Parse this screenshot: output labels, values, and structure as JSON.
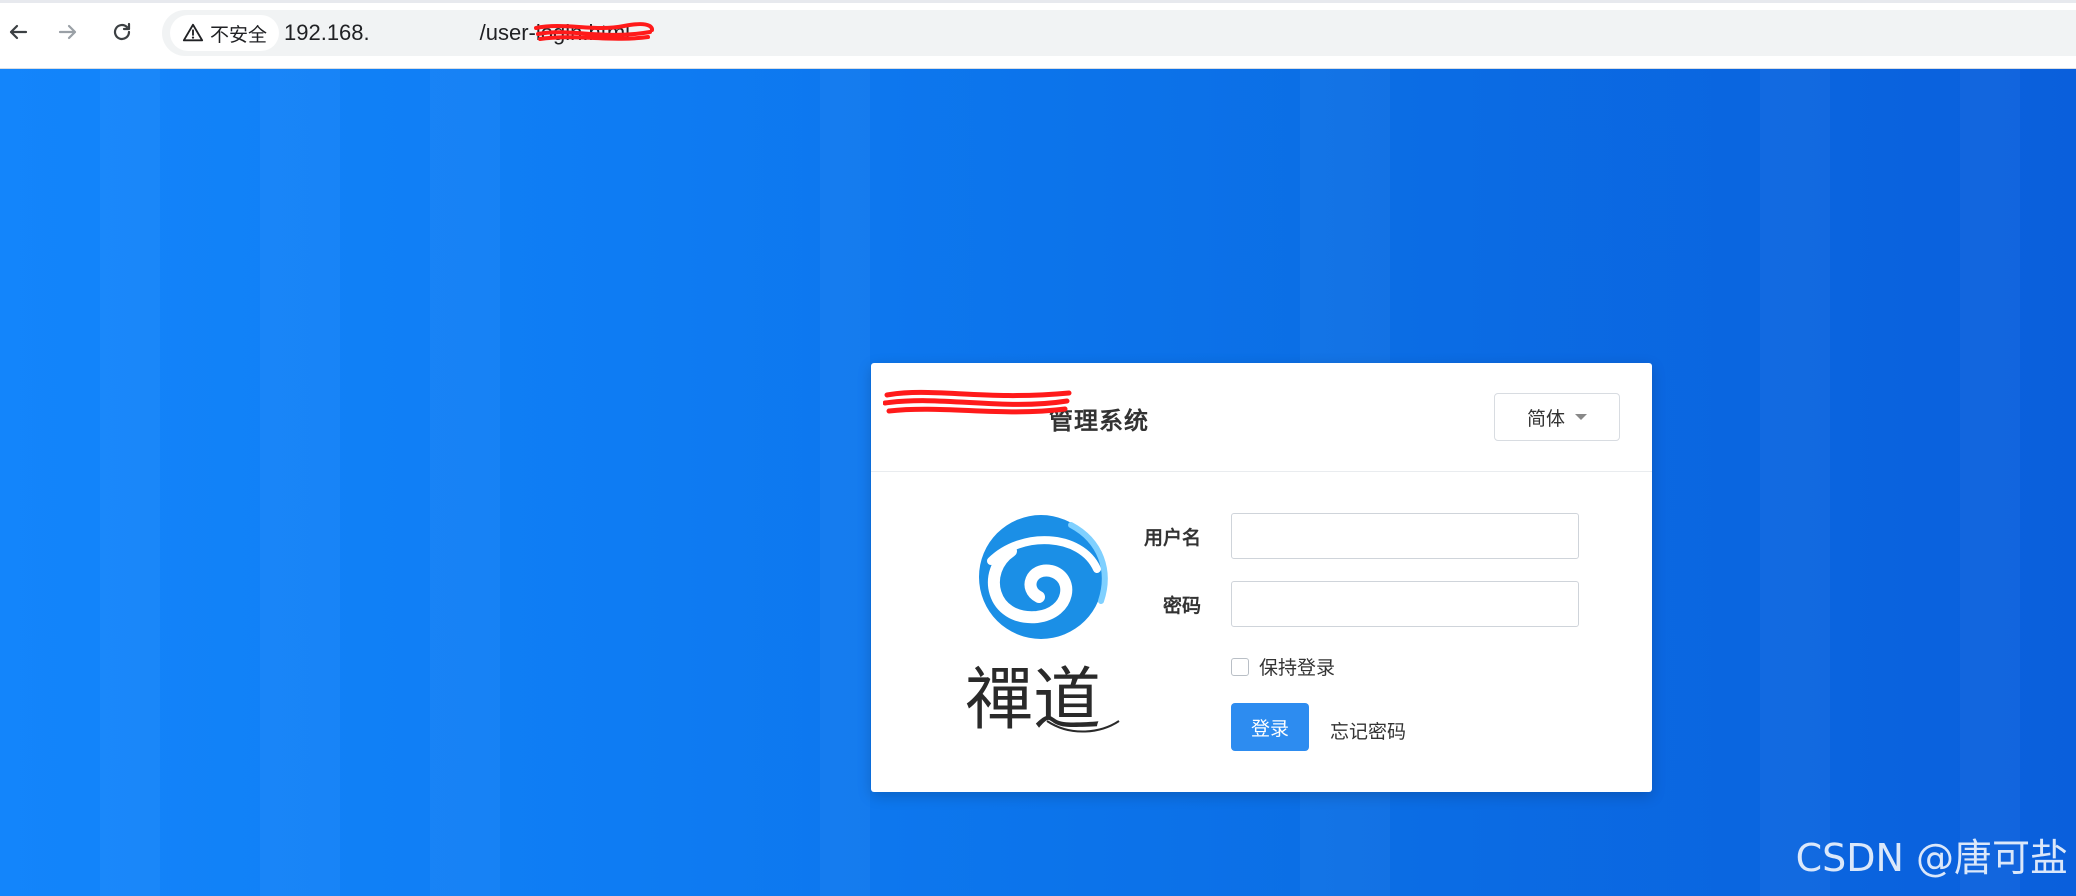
{
  "browser": {
    "security_label": "不安全",
    "url_prefix": "192.168.",
    "url_suffix": "/user-login.html"
  },
  "header": {
    "title": "管理系统",
    "language_label": "简体"
  },
  "logo": {
    "text": "禪道"
  },
  "form": {
    "username_label": "用户名",
    "username_value": "",
    "password_label": "密码",
    "password_value": "",
    "remember_label": "保持登录",
    "remember_checked": false,
    "login_label": "登录",
    "forgot_label": "忘记密码"
  },
  "watermark": "CSDN @唐可盐",
  "colors": {
    "background": "#0b6fe6",
    "primary_button": "#2d8cf0",
    "logo_blue": "#1b8fe6"
  }
}
